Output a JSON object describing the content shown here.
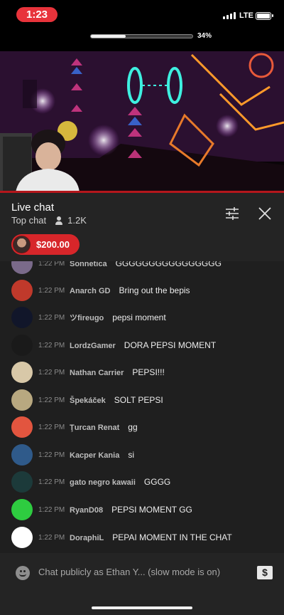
{
  "status_bar": {
    "time": "1:23",
    "network": "LTE"
  },
  "progress": {
    "label": "34%",
    "value": 0.34
  },
  "video_progress": 1.0,
  "chat_header": {
    "title": "Live chat",
    "mode": "Top chat",
    "viewer_count": "1.2K",
    "filter_icon": "tune-icon",
    "close_icon": "close-icon"
  },
  "superchat": {
    "amount": "$200.00"
  },
  "messages": [
    {
      "time": "1:22 PM",
      "author": "Sonnetica",
      "text": "GGGGGGGGGGGGGGGG",
      "avatar_color": "#7a6a8a"
    },
    {
      "time": "1:22 PM",
      "author": "Anarch GD",
      "text": "Bring out the bepis",
      "avatar_color": "#c0392b"
    },
    {
      "time": "1:22 PM",
      "author": "ツfireugo",
      "text": "pepsi moment",
      "avatar_color": "#11162a"
    },
    {
      "time": "1:22 PM",
      "author": "LordzGamer",
      "text": "DORA PEPSI MOMENT",
      "avatar_color": "#1a1a1a"
    },
    {
      "time": "1:22 PM",
      "author": "Nathan Carrier",
      "text": "PEPSI!!!",
      "avatar_color": "#d8c8a8"
    },
    {
      "time": "1:22 PM",
      "author": "Špekáček",
      "text": "SOLT PEPSI",
      "avatar_color": "#b8a880"
    },
    {
      "time": "1:22 PM",
      "author": "Ţurcan Renat",
      "text": "gg",
      "avatar_color": "#e2553f"
    },
    {
      "time": "1:22 PM",
      "author": "Kacper Kania",
      "text": "si",
      "avatar_color": "#2f5a8a"
    },
    {
      "time": "1:22 PM",
      "author": "gato negro kawaii",
      "text": "GGGG",
      "avatar_color": "#1c3a3a"
    },
    {
      "time": "1:22 PM",
      "author": "RyanD08",
      "text": "PEPSI MOMENT GG",
      "avatar_color": "#2ecc40"
    },
    {
      "time": "1:22 PM",
      "author": "DoraphiL",
      "text": "PEPAI MOMENT IN THE CHAT",
      "avatar_color": "#ffffff"
    }
  ],
  "input": {
    "placeholder": "Chat publicly as Ethan Y... (slow mode is on)",
    "emoji_icon": "emoji-icon",
    "super_chat_icon": "dollar-icon"
  }
}
